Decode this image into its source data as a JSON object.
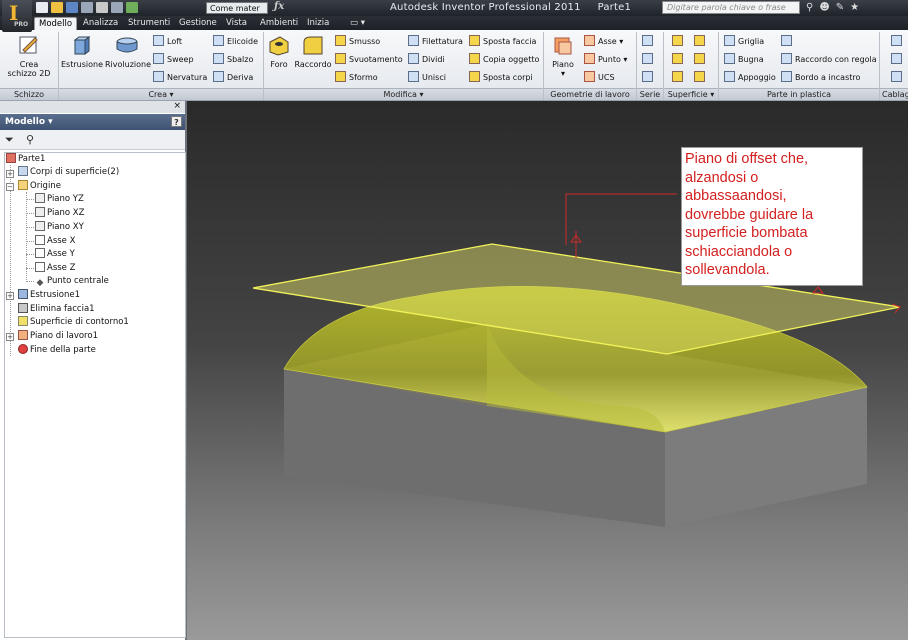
{
  "window": {
    "title": "Autodesk Inventor Professional 2011",
    "document": "Parte1",
    "app_letter": "I",
    "edition": "PRO",
    "material": "Come mater",
    "search_placeholder": "Digitare parola chiave o frase"
  },
  "tabs": [
    "Modello",
    "Analizza",
    "Strumenti",
    "Gestione",
    "Vista",
    "Ambienti",
    "Inizia"
  ],
  "active_tab": "Modello",
  "ribbon": {
    "schizzo": {
      "group": "Schizzo",
      "crea_line1": "Crea",
      "crea_line2": "schizzo 2D"
    },
    "crea": {
      "group": "Crea",
      "estrusione": "Estrusione",
      "rivoluzione": "Rivoluzione",
      "loft": "Loft",
      "sweep": "Sweep",
      "nervatura": "Nervatura",
      "elicoide": "Elicoide",
      "sbalzo": "Sbalzo",
      "deriva": "Deriva"
    },
    "modifica": {
      "group": "Modifica",
      "foro": "Foro",
      "raccordo": "Raccordo",
      "smusso": "Smusso",
      "svuotamento": "Svuotamento",
      "sformo": "Sformo",
      "filettatura": "Filettatura",
      "dividi": "Dividi",
      "unisci": "Unisci",
      "sposta_faccia": "Sposta faccia",
      "copia_oggetto": "Copia oggetto",
      "sposta_corpi": "Sposta corpi"
    },
    "geometrie": {
      "group": "Geometrie di lavoro",
      "piano": "Piano",
      "asse": "Asse",
      "punto": "Punto",
      "ucs": "UCS"
    },
    "serie": {
      "group": "Serie"
    },
    "superficie": {
      "group": "Superficie"
    },
    "plastica": {
      "group": "Parte in plastica",
      "griglia": "Griglia",
      "bugna": "Bugna",
      "appoggio": "Appoggio",
      "raccordo_regola": "Raccordo con regola",
      "bordo_incastro": "Bordo a incastro"
    },
    "cablaggio": {
      "group": "Cablag"
    }
  },
  "browser": {
    "title": "Modello",
    "close": "×",
    "help": "?",
    "tree": [
      {
        "label": "Parte1",
        "level": 0
      },
      {
        "label": "Corpi di superficie(2)",
        "level": 1
      },
      {
        "label": "Origine",
        "level": 1
      },
      {
        "label": "Piano YZ",
        "level": 2
      },
      {
        "label": "Piano XZ",
        "level": 2
      },
      {
        "label": "Piano XY",
        "level": 2
      },
      {
        "label": "Asse X",
        "level": 2
      },
      {
        "label": "Asse Y",
        "level": 2
      },
      {
        "label": "Asse Z",
        "level": 2
      },
      {
        "label": "Punto centrale",
        "level": 2
      },
      {
        "label": "Estrusione1",
        "level": 1
      },
      {
        "label": "Elimina faccia1",
        "level": 1
      },
      {
        "label": "Superficie di contorno1",
        "level": 1
      },
      {
        "label": "Piano di lavoro1",
        "level": 1
      },
      {
        "label": "Fine della parte",
        "level": 1
      }
    ]
  },
  "annotation": {
    "lines": [
      "Piano di offset che,",
      "alzandosi o",
      "abbassaandosi,",
      "dovrebbe guidare la",
      "superficie bombata",
      "schiacciandola o",
      "sollevandola."
    ],
    "color": "#d42020"
  },
  "colors": {
    "plane": "#e6e66a",
    "surface": "#d7dc3a",
    "box": "#8a8a8a"
  }
}
